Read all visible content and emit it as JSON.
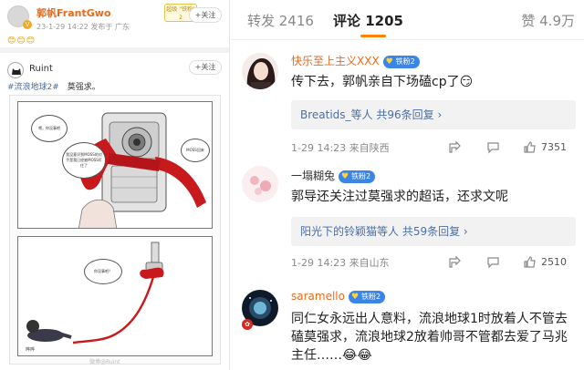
{
  "left": {
    "post": {
      "author": "郭帆FrantGwo",
      "verified_badge": "V",
      "meta": "23-1-29 14:22  发布于 广东",
      "stamp_text": "超级 \"铁粉\" 2",
      "follow_label": "+关注",
      "emojis": "😊😊😊"
    },
    "repost": {
      "author": "Ruint",
      "follow_label": "+关注",
      "tag": "#流浪地球2#",
      "text": "莫强求。"
    },
    "comic": {
      "bubble1": "喂，你没事吧",
      "bubble2": "我没意识到MOSS的对手是我已经被MOSS盯住了",
      "bubble3": "MOSS回来",
      "bubble4": "你没事吧？",
      "caption": "哗哗"
    },
    "watermark": "微博@Ruint"
  },
  "tabs": {
    "repost": "转发 2416",
    "comment": "评论 1205",
    "like": "赞 4.9万"
  },
  "comments": [
    {
      "user": "快乐至上主义XXX",
      "fan_badge": "铁粉2",
      "text": "传下去，郭帆亲自下场磕cp了😏",
      "reply_who": "Breatids_等人",
      "reply_count": "共96条回复 ›",
      "time": "1-29 14:23  来自陕西",
      "likes": "7351"
    },
    {
      "user": "一塌糊兔",
      "fan_badge": "铁粉2",
      "text": "郭导还关注过莫强求的超话，还求文呢",
      "reply_who": "阳光下的铃颖猫等人",
      "reply_count": "共59条回复 ›",
      "time": "1-29 14:23  来自山东",
      "likes": "2510"
    },
    {
      "user": "saramello",
      "fan_badge": "铁粉2",
      "text": "同仁女永远出人意料，流浪地球1时放着人不管去磕莫强求，流浪地球2放着帅哥不管都去爱了马兆主任……😂😂"
    }
  ],
  "colors": {
    "accent": "#ff8200",
    "link": "#4a6ea8",
    "fan_badge": "#3a85e6",
    "author_name": "#e86b1c"
  }
}
